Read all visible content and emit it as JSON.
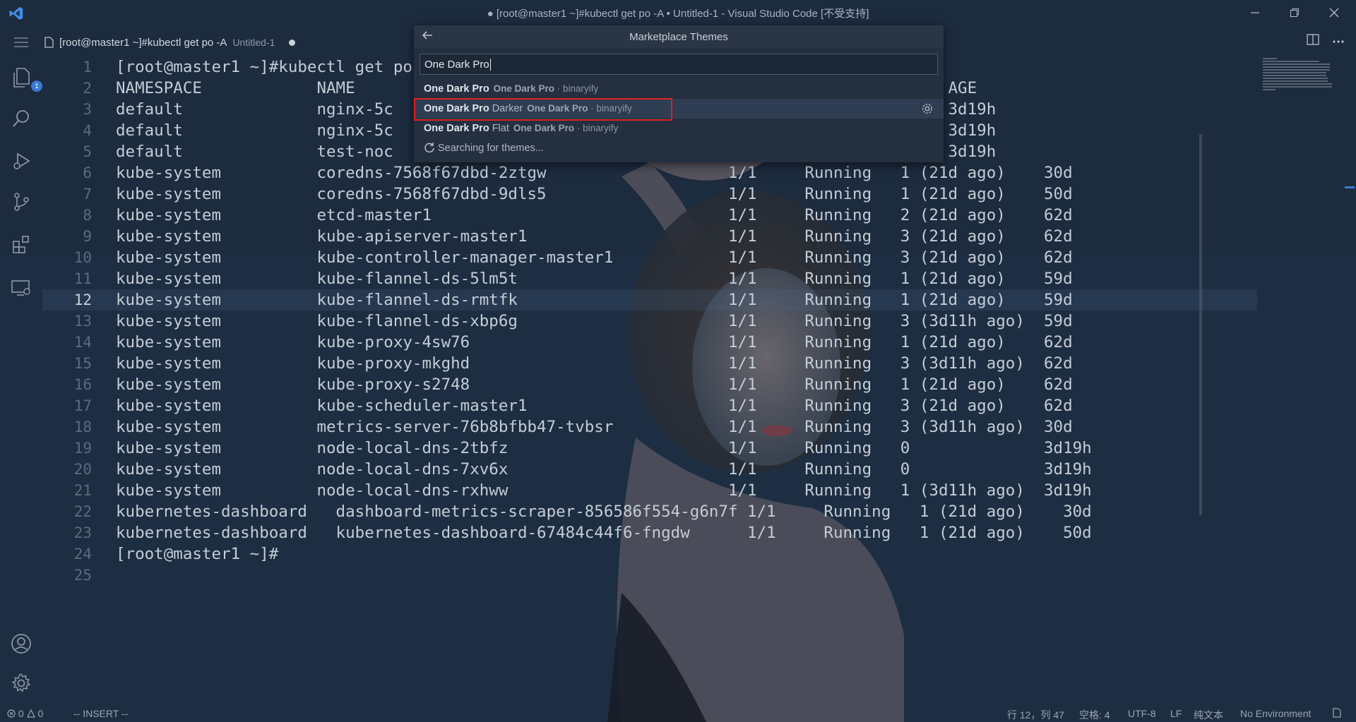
{
  "window": {
    "title": "● [root@master1 ~]#kubectl get po -A • Untitled-1 - Visual Studio Code [不受支持]"
  },
  "activity_bar": {
    "explorer_badge": "1"
  },
  "tab": {
    "label": "[root@master1 ~]#kubectl get po -A",
    "sub": "Untitled-1"
  },
  "quick_pick": {
    "title": "Marketplace Themes",
    "input_value": "One Dark Pro",
    "items": [
      {
        "name_bold": "One Dark Pro",
        "name_rest": "",
        "desc_bold": "One Dark Pro",
        "desc_rest": " · binaryify"
      },
      {
        "name_bold": "One Dark Pro",
        "name_rest": " Darker",
        "desc_bold": "One Dark Pro",
        "desc_rest": " · binaryify"
      },
      {
        "name_bold": "One Dark Pro",
        "name_rest": " Flat",
        "desc_bold": "One Dark Pro",
        "desc_rest": " · binaryify"
      }
    ],
    "searching_text": "Searching for themes..."
  },
  "editor": {
    "active_line": 12,
    "lines": [
      {
        "n": "1",
        "text": "[root@master1 ~]#kubectl get po"
      },
      {
        "n": "2",
        "text": "NAMESPACE            NAME                                               RESTARTS       AGE"
      },
      {
        "n": "3",
        "text": "default              nginx-5c                                           0              3d19h"
      },
      {
        "n": "4",
        "text": "default              nginx-5c                                           1 (3d11h ago)  3d19h"
      },
      {
        "n": "5",
        "text": "default              test-noc                                           10 (16m ago)   3d19h"
      },
      {
        "n": "6",
        "text": "kube-system          coredns-7568f67dbd-2ztgw                   1/1     Running   1 (21d ago)    30d"
      },
      {
        "n": "7",
        "text": "kube-system          coredns-7568f67dbd-9dls5                   1/1     Running   1 (21d ago)    50d"
      },
      {
        "n": "8",
        "text": "kube-system          etcd-master1                               1/1     Running   2 (21d ago)    62d"
      },
      {
        "n": "9",
        "text": "kube-system          kube-apiserver-master1                     1/1     Running   3 (21d ago)    62d"
      },
      {
        "n": "10",
        "text": "kube-system          kube-controller-manager-master1            1/1     Running   3 (21d ago)    62d"
      },
      {
        "n": "11",
        "text": "kube-system          kube-flannel-ds-5lm5t                      1/1     Running   1 (21d ago)    59d"
      },
      {
        "n": "12",
        "text": "kube-system          kube-flannel-ds-rmtfk                      1/1     Running   1 (21d ago)    59d"
      },
      {
        "n": "13",
        "text": "kube-system          kube-flannel-ds-xbp6g                      1/1     Running   3 (3d11h ago)  59d"
      },
      {
        "n": "14",
        "text": "kube-system          kube-proxy-4sw76                           1/1     Running   1 (21d ago)    62d"
      },
      {
        "n": "15",
        "text": "kube-system          kube-proxy-mkghd                           1/1     Running   3 (3d11h ago)  62d"
      },
      {
        "n": "16",
        "text": "kube-system          kube-proxy-s2748                           1/1     Running   1 (21d ago)    62d"
      },
      {
        "n": "17",
        "text": "kube-system          kube-scheduler-master1                     1/1     Running   3 (21d ago)    62d"
      },
      {
        "n": "18",
        "text": "kube-system          metrics-server-76b8bfbb47-tvbsr            1/1     Running   3 (3d11h ago)  30d"
      },
      {
        "n": "19",
        "text": "kube-system          node-local-dns-2tbfz                       1/1     Running   0              3d19h"
      },
      {
        "n": "20",
        "text": "kube-system          node-local-dns-7xv6x                       1/1     Running   0              3d19h"
      },
      {
        "n": "21",
        "text": "kube-system          node-local-dns-rxhww                       1/1     Running   1 (3d11h ago)  3d19h"
      },
      {
        "n": "22",
        "text": "kubernetes-dashboard   dashboard-metrics-scraper-856586f554-g6n7f 1/1     Running   1 (21d ago)    30d"
      },
      {
        "n": "23",
        "text": "kubernetes-dashboard   kubernetes-dashboard-67484c44f6-fngdw      1/1     Running   1 (21d ago)    50d"
      },
      {
        "n": "24",
        "text": "[root@master1 ~]#"
      },
      {
        "n": "25",
        "text": ""
      }
    ]
  },
  "status_bar": {
    "errors": "0",
    "warnings": "0",
    "mode": "-- INSERT --",
    "position": "行 12，列 47",
    "spaces": "空格: 4",
    "encoding": "UTF-8",
    "eol": "LF",
    "language": "纯文本",
    "environment": "No Environment"
  },
  "colors": {
    "accent": "#3d7bd4",
    "highlight_border": "#e02020"
  }
}
